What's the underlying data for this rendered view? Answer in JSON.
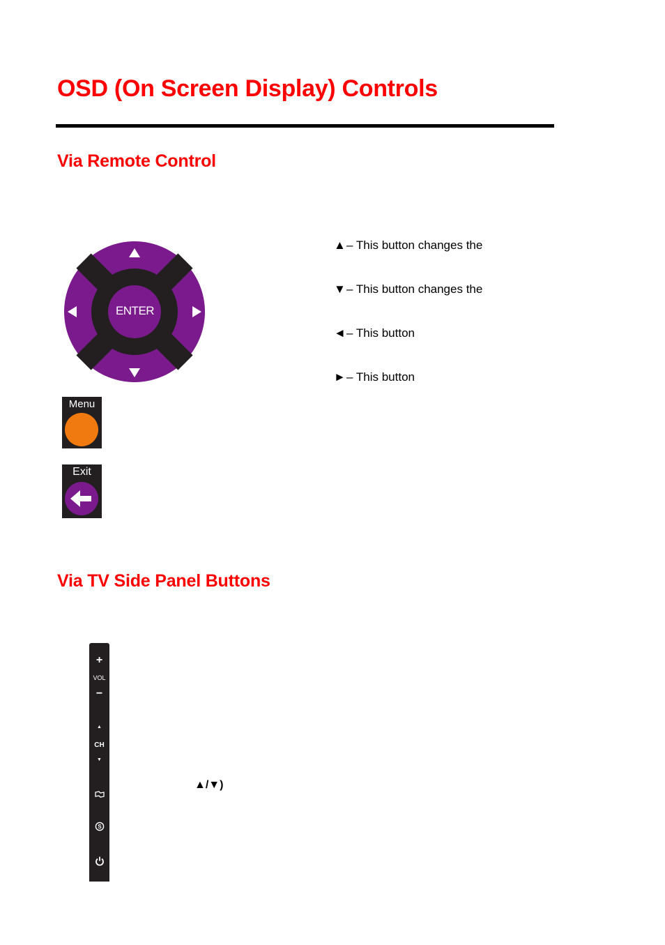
{
  "title": "OSD (On Screen Display) Controls",
  "sections": {
    "remote": {
      "heading": "Via Remote Control",
      "dpad": {
        "center_label": "ENTER",
        "up_icon": "triangle-up",
        "down_icon": "triangle-down",
        "left_icon": "triangle-left",
        "right_icon": "triangle-right",
        "ring_color": "#7a1a8c",
        "cross_color": "#231f20"
      },
      "descriptions": [
        {
          "symbol": "▲",
          "text": "– This button changes the"
        },
        {
          "symbol": "▼",
          "text": "– This button changes the"
        },
        {
          "symbol": "◄",
          "text": "– This button"
        },
        {
          "symbol": "►",
          "text": "– This button"
        }
      ],
      "menu_button": {
        "label": "Menu",
        "color": "#f07a0f"
      },
      "exit_button": {
        "label": "Exit",
        "icon": "arrow-left",
        "color": "#7a1a8c"
      }
    },
    "side_panel": {
      "heading": "Via TV Side Panel Buttons",
      "buttons": {
        "vol_plus": "+",
        "vol_label": "VOL",
        "vol_minus": "−",
        "ch_up": "▲",
        "ch_label": "CH",
        "ch_down": "▼",
        "input_icon": "input-source-icon",
        "s_label": "S",
        "power_icon": "power-icon"
      },
      "arrow_note": "▲/▼)"
    }
  }
}
